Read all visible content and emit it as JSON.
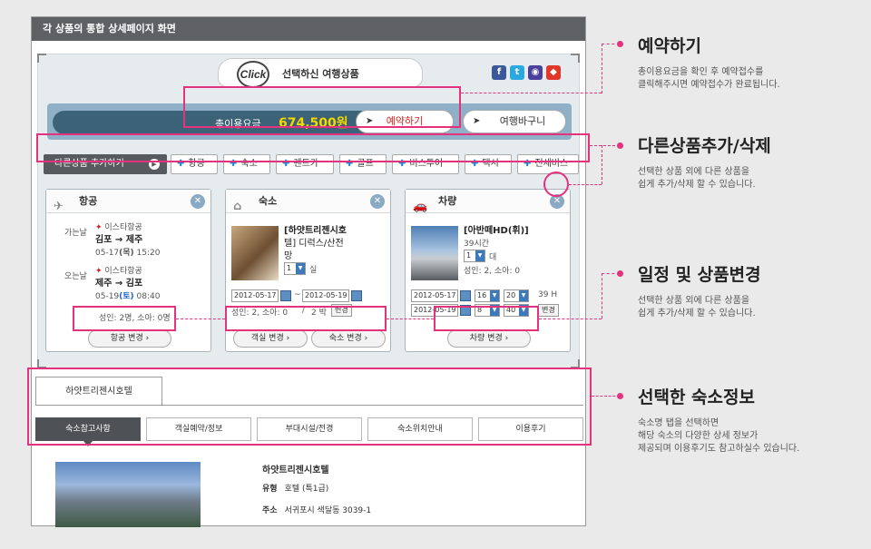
{
  "header": {
    "title": "각 상품의 통합 상세페이지 화면"
  },
  "panel": {
    "logo": "Click",
    "title": "선택하신 여행상품",
    "social": [
      {
        "icon": "facebook-icon",
        "glyph": "f",
        "color": "#3b5998"
      },
      {
        "icon": "twitter-icon",
        "glyph": "t",
        "color": "#2aa9e0"
      },
      {
        "icon": "chat-icon",
        "glyph": "◉",
        "color": "#4a3f9b"
      },
      {
        "icon": "me2day-icon",
        "glyph": "◆",
        "color": "#e0392b"
      }
    ]
  },
  "price": {
    "label": "총이용요금",
    "value": "674,500원",
    "reserve_button": "예약하기",
    "cart_button": "여행바구니"
  },
  "categories": {
    "first": "다른상품 추가하기",
    "items": [
      "항공",
      "숙소",
      "렌트카",
      "골프",
      "버스투어",
      "택시",
      "전세버스"
    ]
  },
  "cards": {
    "flight": {
      "title": "항공",
      "out_label": "가는날",
      "out_airline": "이스타항공",
      "out_route": "김포 → 제주",
      "out_date": "05-17",
      "out_day": "(목)",
      "out_time": "15:20",
      "ret_label": "오는날",
      "ret_airline": "이스타항공",
      "ret_route": "제주 → 김포",
      "ret_date": "05-19",
      "ret_day": "(토)",
      "ret_time": "08:40",
      "pax": "성인: 2명, 소아: 0명",
      "change_button": "항공 변경"
    },
    "hotel": {
      "title": "숙소",
      "name_line1": "[하얏트리젠시호",
      "name_line2": "텔] 디럭스/산전",
      "name_line3": "망",
      "rooms": "1",
      "rooms_unit": "실",
      "date_from": "2012-05-17",
      "tilde": "~",
      "date_to": "2012-05-19",
      "pax": "성인: 2, 소아: 0",
      "nights_sep": "/",
      "nights": "2 박",
      "change_small": "변경",
      "room_button": "객실 변경",
      "hotel_button": "숙소 변경"
    },
    "car": {
      "title": "차량",
      "name": "[아반떼HD(휘)]",
      "hours": "39시간",
      "count": "1",
      "count_unit": "대",
      "pax": "성인: 2, 소아: 0",
      "date_from": "2012-05-17",
      "from_h": "16",
      "from_m": "20",
      "total": "39 H",
      "date_to": "2012-05-19",
      "to_h": "8",
      "to_m": "40",
      "change_small": "변경",
      "change_button": "차량 변경"
    }
  },
  "hotel_section": {
    "tab": "하얏트리젠시호텔",
    "subtabs": [
      "숙소참고사항",
      "객실예약/정보",
      "부대시설/전경",
      "숙소위치안내",
      "이용후기"
    ],
    "name": "하얏트리젠시호텔",
    "type_label": "유형",
    "type_value": "호텔 (특1급)",
    "addr_label": "주소",
    "addr_value": "서귀포시 색달동 3039-1"
  },
  "annotations": [
    {
      "title": "예약하기",
      "desc1": "총이용요금을 확인 후 예약접수를",
      "desc2": "클릭해주시면 예약접수가 완료됩니다.",
      "desc3": ""
    },
    {
      "title": "다른상품추가/삭제",
      "desc1": "선택한 상품 외에 다른 상품을",
      "desc2": "쉽게 추가/삭제 할 수 있습니다.",
      "desc3": ""
    },
    {
      "title": "일정 및 상품변경",
      "desc1": "선택한 상품 외에 다른 상품을",
      "desc2": "쉽게 추가/삭제 할 수 있습니다.",
      "desc3": ""
    },
    {
      "title": "선택한 숙소정보",
      "desc1": "숙소명 탭을 선택하면",
      "desc2": "해당 숙소의 다양한 상세 정보가",
      "desc3": "제공되며 이용후기도 참고하실수 있습니다."
    }
  ],
  "colors": {
    "highlight": "#e4327f",
    "price": "#f5d800",
    "accent": "#1e7fc8"
  }
}
